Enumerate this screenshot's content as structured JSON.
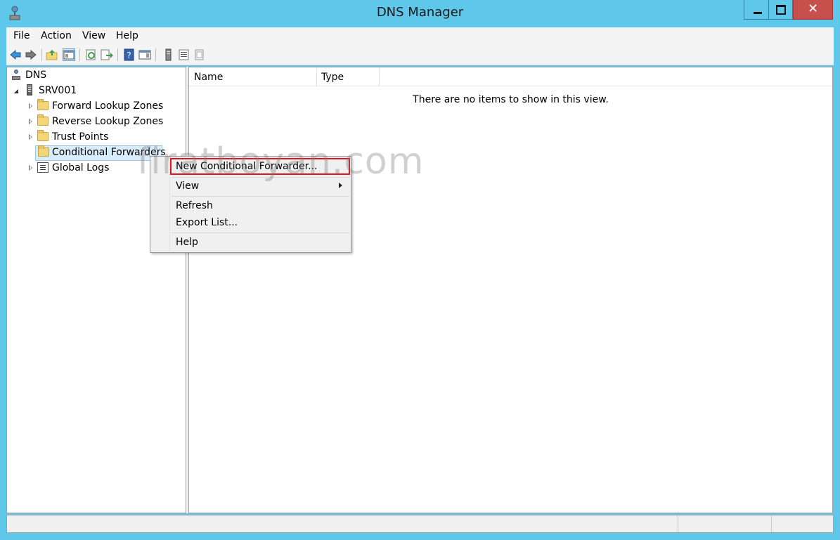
{
  "window": {
    "title": "DNS Manager",
    "close_glyph": "✕"
  },
  "menubar": [
    "File",
    "Action",
    "View",
    "Help"
  ],
  "toolbar": {
    "icons": [
      "back-icon",
      "forward-icon",
      "up-folder-icon",
      "show-hide-console-tree-icon",
      "refresh-icon",
      "export-list-icon",
      "help-icon",
      "show-hide-action-pane-icon",
      "server-icon",
      "list-icon",
      "properties-icon"
    ]
  },
  "tree": {
    "root": "DNS",
    "server": "SRV001",
    "children": [
      "Forward Lookup Zones",
      "Reverse Lookup Zones",
      "Trust Points",
      "Conditional Forwarders",
      "Global Logs"
    ]
  },
  "list": {
    "columns": [
      "Name",
      "Type"
    ],
    "empty_message": "There are no items to show in this view."
  },
  "context_menu": {
    "items": [
      "New Conditional Forwarder...",
      "View",
      "Refresh",
      "Export List...",
      "Help"
    ]
  },
  "watermark": "firatboyan.com"
}
